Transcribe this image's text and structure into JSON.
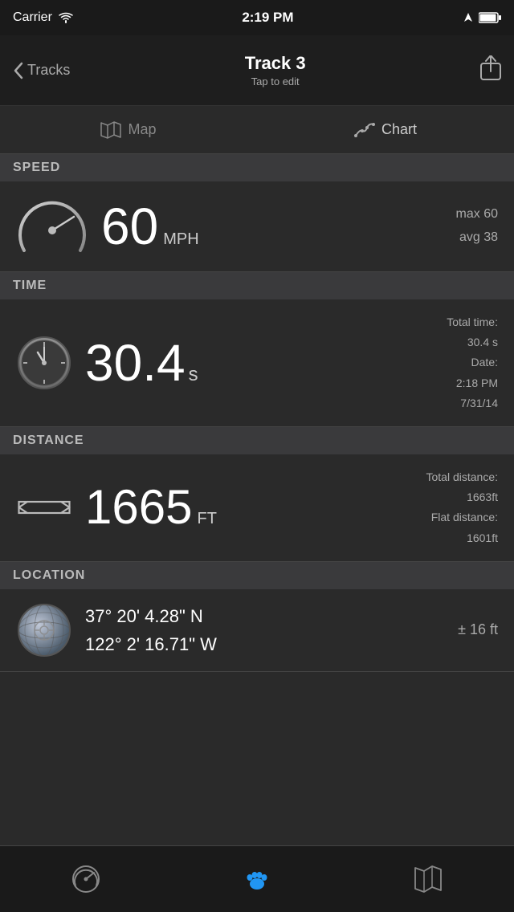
{
  "statusBar": {
    "carrier": "Carrier",
    "time": "2:19 PM"
  },
  "navBar": {
    "backLabel": "Tracks",
    "title": "Track 3",
    "subtitle": "Tap to edit"
  },
  "tabs": [
    {
      "id": "map",
      "label": "Map",
      "icon": "map"
    },
    {
      "id": "chart",
      "label": "Chart",
      "icon": "chart"
    }
  ],
  "speed": {
    "sectionLabel": "SPEED",
    "value": "60",
    "unit": "MPH",
    "max": "max 60",
    "avg": "avg 38"
  },
  "time": {
    "sectionLabel": "TIME",
    "value": "30.4",
    "unit": "s",
    "totalTimeLabel": "Total time:",
    "totalTimeValue": "30.4 s",
    "dateLabel": "Date:",
    "dateValue": "2:18 PM",
    "dateDay": "7/31/14"
  },
  "distance": {
    "sectionLabel": "DISTANCE",
    "value": "1665",
    "unit": "FT",
    "totalDistLabel": "Total distance:",
    "totalDistValue": "1663ft",
    "flatDistLabel": "Flat distance:",
    "flatDistValue": "1601ft"
  },
  "location": {
    "sectionLabel": "LOCATION",
    "lat": "37° 20' 4.28\" N",
    "lon": "122° 2' 16.71\" W",
    "accuracy": "± 16 ft"
  },
  "tabBar": {
    "items": [
      {
        "id": "speedometer",
        "icon": "speedometer"
      },
      {
        "id": "paw",
        "icon": "paw",
        "active": true
      },
      {
        "id": "map",
        "icon": "map"
      }
    ]
  }
}
